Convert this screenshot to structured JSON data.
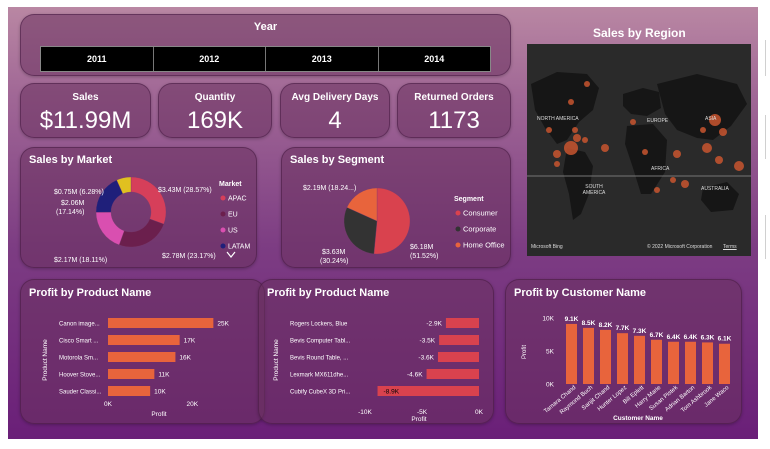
{
  "year_slicer": {
    "title": "Year",
    "years": [
      "2011",
      "2012",
      "2013",
      "2014"
    ]
  },
  "kpis": [
    {
      "label": "Sales",
      "value": "$11.99M"
    },
    {
      "label": "Quantity",
      "value": "169K"
    },
    {
      "label": "Avg Delivery Days",
      "value": "4"
    },
    {
      "label": "Returned Orders",
      "value": "1173"
    }
  ],
  "sales_by_region": {
    "title": "Sales by Region",
    "continent_labels": [
      "NORTH AMERICA",
      "EUROPE",
      "ASIA",
      "AFRICA",
      "SOUTH AMERICA",
      "AUSTRALIA"
    ],
    "credit": "© 2022 Microsoft Corporation",
    "terms": "Terms",
    "logo": "Microsoft Bing"
  },
  "colors": {
    "accent": "#e8643c",
    "donut_apac": "#d63f5a",
    "donut_eu": "#6b1f4d",
    "donut_us": "#d94fb0",
    "donut_latam": "#1f1f7a",
    "donut_africa": "#e0c020",
    "consumer": "#d9424e",
    "corporate": "#333333",
    "home_office": "#e8643c"
  },
  "chart_data": [
    {
      "type": "pie",
      "title": "Sales by Market",
      "legend_title": "Market",
      "legend": [
        "APAC",
        "EU",
        "US",
        "LATAM"
      ],
      "slices": [
        {
          "label": "APAC",
          "value": 3.43,
          "text": "$3.43M (28.57%)"
        },
        {
          "label": "EU",
          "value": 2.78,
          "text": "$2.78M (23.17%)"
        },
        {
          "label": "US",
          "value": 2.17,
          "text": "$2.17M (18.11%)"
        },
        {
          "label": "LATAM",
          "value": 2.06,
          "text": "$2.06M (17.14%)"
        },
        {
          "label": "",
          "value": 0.75,
          "text": "$0.75M (6.28%)"
        }
      ]
    },
    {
      "type": "pie",
      "title": "Sales by Segment",
      "legend_title": "Segment",
      "legend": [
        "Consumer",
        "Corporate",
        "Home Office"
      ],
      "slices": [
        {
          "label": "Consumer",
          "value": 6.18,
          "text_value": "$6.18M",
          "text_pct": "(51.52%)"
        },
        {
          "label": "Corporate",
          "value": 3.63,
          "text_value": "$3.63M",
          "text_pct": "(30.24%)"
        },
        {
          "label": "Home Office",
          "value": 2.19,
          "text_value": "$2.19M (18.24...)",
          "text_pct": ""
        }
      ]
    },
    {
      "type": "bar",
      "title": "Profit by Product Name",
      "orientation": "horizontal",
      "categories": [
        "Canon image...",
        "Cisco Smart ...",
        "Motorola Sm...",
        "Hoover Stove...",
        "Sauder Classi..."
      ],
      "values": [
        25000,
        17000,
        16000,
        11000,
        10000
      ],
      "value_labels": [
        "25K",
        "17K",
        "16K",
        "11K",
        "10K"
      ],
      "xlabel": "Profit",
      "ylabel": "Product Name",
      "xlim": [
        0,
        28000
      ],
      "ticks": [
        0,
        20000
      ],
      "tick_labels": [
        "0K",
        "20K"
      ]
    },
    {
      "type": "bar",
      "title": "Profit by Product Name",
      "orientation": "horizontal",
      "categories": [
        "Rogers Lockers, Blue",
        "Bevis Computer Tabl...",
        "Bevis Round Table, ...",
        "Lexmark MX611dhe...",
        "Cubify CubeX 3D Pri..."
      ],
      "values": [
        -2900,
        -3500,
        -3600,
        -4600,
        -8900
      ],
      "value_labels": [
        "-2.9K",
        "-3.5K",
        "-3.6K",
        "-4.6K",
        "-8.9K"
      ],
      "xlabel": "Profit",
      "ylabel": "Product Name",
      "xlim": [
        -10000,
        0
      ],
      "ticks": [
        -10000,
        -5000,
        0
      ],
      "tick_labels": [
        "-10K",
        "-5K",
        "0K"
      ]
    },
    {
      "type": "bar",
      "title": "Profit by Customer Name",
      "orientation": "vertical",
      "categories": [
        "Tamara Chand",
        "Raymond Buch",
        "Sanjit Chand",
        "Hunter Lopez",
        "Bill Eplett",
        "Harry Marie",
        "Susan Pistek",
        "Adrian Barton",
        "Tom Ashbrook",
        "Jane Waco"
      ],
      "values": [
        9100,
        8500,
        8200,
        7700,
        7300,
        6700,
        6400,
        6400,
        6300,
        6100
      ],
      "value_labels": [
        "9.1K",
        "8.5K",
        "8.2K",
        "7.7K",
        "7.3K",
        "6.7K",
        "6.4K",
        "6.4K",
        "6.3K",
        "6.1K"
      ],
      "xlabel": "Customer Name",
      "ylabel": "Profit",
      "ylim": [
        0,
        10000
      ],
      "ticks": [
        0,
        5000,
        10000
      ],
      "tick_labels": [
        "0K",
        "5K",
        "10K"
      ]
    }
  ]
}
